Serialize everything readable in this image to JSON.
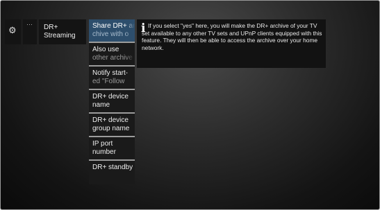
{
  "nav": {
    "settings_icon": "gear-icon",
    "settings_glyph": "⚙",
    "more_glyph": "···",
    "current_item": {
      "line1": "DR+",
      "line2": "Streaming"
    }
  },
  "menu": {
    "items": [
      {
        "line1": "Share DR+ ar-",
        "line2": "chive with o",
        "selected": true
      },
      {
        "line1": "Also use",
        "line2": "other archive",
        "selected": false
      },
      {
        "line1": "Notify start-",
        "line2": "ed \"Follow",
        "selected": false
      },
      {
        "line1": "DR+ device",
        "line2": "name",
        "selected": false
      },
      {
        "line1": "DR+ device",
        "line2": "group name",
        "selected": false
      },
      {
        "line1": "IP port",
        "line2": "number",
        "selected": false
      },
      {
        "line1": "DR+ standby",
        "line2": "",
        "selected": false
      }
    ]
  },
  "info": {
    "icon": "info-icon",
    "icon_glyph": "i",
    "text": "If you select \"yes\" here, you will make the DR+ archive of your TV set available to any other TV sets and UPnP clients equipped with this feature. They will then be able to access the archive over your home network."
  },
  "colors": {
    "selected_bg": "#2d4e6c",
    "tile_bg": "#141414",
    "divider": "#9c9c9c"
  }
}
